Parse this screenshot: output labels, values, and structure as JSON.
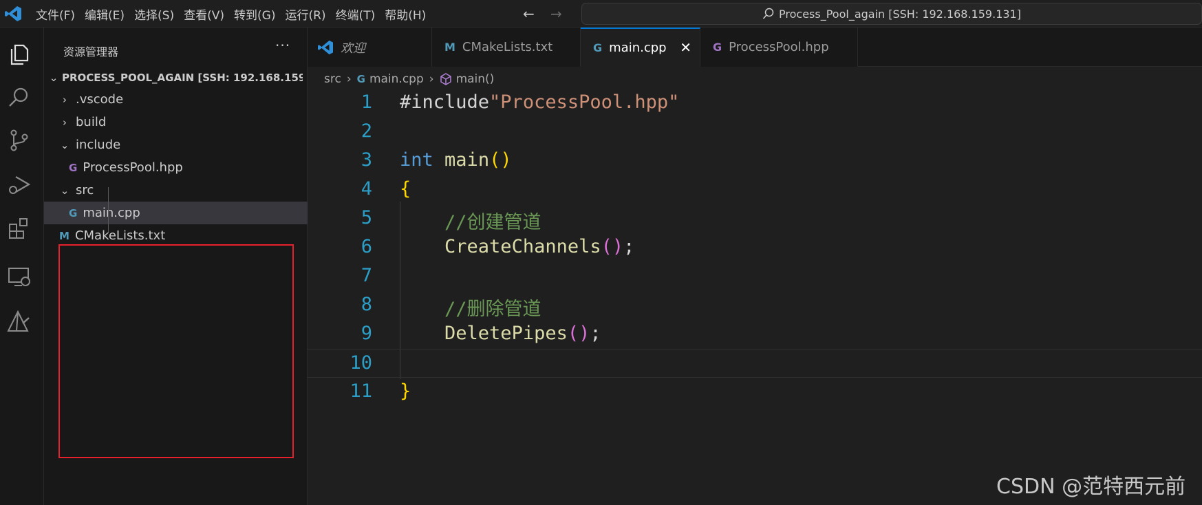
{
  "titlebar": {
    "menu": [
      "文件(F)",
      "编辑(E)",
      "选择(S)",
      "查看(V)",
      "转到(G)",
      "运行(R)",
      "终端(T)",
      "帮助(H)"
    ],
    "search_text": "Process_Pool_again [SSH: 192.168.159.131]"
  },
  "activitybar": {
    "icons": [
      "explorer-icon",
      "search-icon",
      "source-control-icon",
      "run-debug-icon",
      "extensions-icon",
      "remote-explorer-icon",
      "cmake-icon"
    ]
  },
  "sidebar": {
    "title": "资源管理器",
    "more": "···",
    "root_label": "PROCESS_POOL_AGAIN [SSH: 192.168.159....",
    "items": [
      {
        "label": ".vscode",
        "kind": "folder",
        "expanded": false
      },
      {
        "label": "build",
        "kind": "folder",
        "expanded": false
      },
      {
        "label": "include",
        "kind": "folder",
        "expanded": true
      },
      {
        "label": "ProcessPool.hpp",
        "kind": "file",
        "icon": "C++ header"
      },
      {
        "label": "src",
        "kind": "folder",
        "expanded": true
      },
      {
        "label": "main.cpp",
        "kind": "file",
        "icon": "C++ source",
        "selected": true
      },
      {
        "label": "CMakeLists.txt",
        "kind": "file",
        "icon": "M"
      }
    ]
  },
  "tabs": [
    {
      "label": "欢迎",
      "icon": "vscode-icon"
    },
    {
      "label": "CMakeLists.txt",
      "icon": "M"
    },
    {
      "label": "main.cpp",
      "icon": "G",
      "active": true,
      "close": "✕"
    },
    {
      "label": "ProcessPool.hpp",
      "icon": "G"
    }
  ],
  "breadcrumb": {
    "folder": "src",
    "file": "main.cpp",
    "symbol": "main()"
  },
  "editor": {
    "line_numbers": [
      "1",
      "2",
      "3",
      "4",
      "5",
      "6",
      "7",
      "8",
      "9",
      "10",
      "11"
    ],
    "lines": [
      [
        {
          "t": "#include",
          "c": "plain"
        },
        {
          "t": "\"ProcessPool.hpp\"",
          "c": "str"
        }
      ],
      [],
      [
        {
          "t": "int",
          "c": "kw"
        },
        {
          "t": " ",
          "c": "plain"
        },
        {
          "t": "main",
          "c": "fn"
        },
        {
          "t": "()",
          "c": "b1"
        }
      ],
      [
        {
          "t": "{",
          "c": "b1"
        }
      ],
      [
        {
          "t": "    //创建管道",
          "c": "cm"
        }
      ],
      [
        {
          "t": "    ",
          "c": "plain"
        },
        {
          "t": "CreateChannels",
          "c": "fn"
        },
        {
          "t": "()",
          "c": "b2"
        },
        {
          "t": ";",
          "c": "plain"
        }
      ],
      [],
      [
        {
          "t": "    //删除管道",
          "c": "cm"
        }
      ],
      [
        {
          "t": "    ",
          "c": "plain"
        },
        {
          "t": "DeletePipes",
          "c": "fn"
        },
        {
          "t": "()",
          "c": "b2"
        },
        {
          "t": ";",
          "c": "plain"
        }
      ],
      [],
      [
        {
          "t": "}",
          "c": "b1"
        }
      ]
    ],
    "current_line": "10"
  },
  "watermark": "CSDN @范特西元前",
  "colors": {
    "accent": "#0078d4",
    "highlight_box": "#e8202c"
  }
}
